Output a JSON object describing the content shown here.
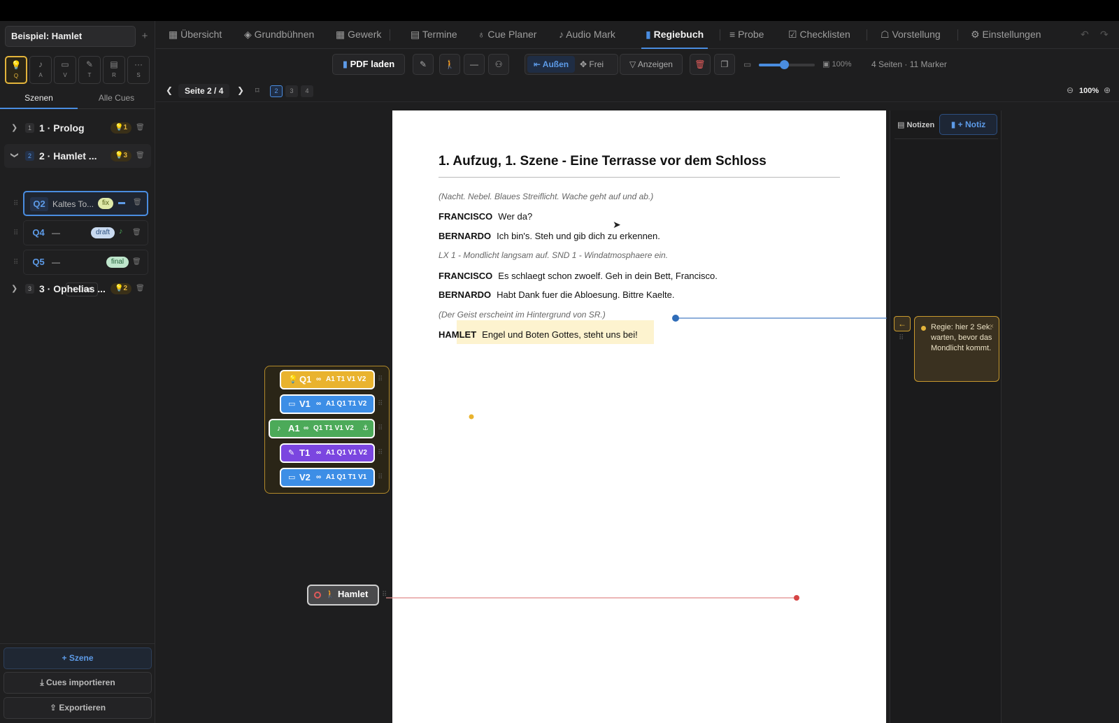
{
  "project": {
    "name": "Beispiel: Hamlet",
    "add": "+"
  },
  "departments": [
    {
      "icon": "💡",
      "letter": "Q"
    },
    {
      "icon": "♪",
      "letter": "A"
    },
    {
      "icon": "▭",
      "letter": "V"
    },
    {
      "icon": "✎",
      "letter": "T"
    },
    {
      "icon": "▤",
      "letter": "R"
    },
    {
      "icon": "···",
      "letter": "S"
    }
  ],
  "sidebar": {
    "tabs": [
      "Szenen",
      "Alle Cues"
    ],
    "scenes": [
      {
        "num": "1",
        "title": "1 · Prolog",
        "count": "1"
      },
      {
        "num": "2",
        "title": "2 · Hamlet ...",
        "count": "3"
      },
      {
        "num": "3",
        "title": "3 · Ophelias ...",
        "count": "2"
      }
    ],
    "cues": [
      {
        "id": "Q2",
        "name": "Kaltes To...",
        "status": "fix"
      },
      {
        "id": "Q4",
        "name": "—",
        "status": "draft"
      },
      {
        "id": "Q5",
        "name": "—",
        "status": "final"
      }
    ],
    "add_cue": "+ Cue",
    "buttons": {
      "scene": "+ Szene",
      "import": "Cues importieren",
      "export": "Exportieren"
    }
  },
  "nav": {
    "tabs": [
      "Übersicht",
      "Grundbühnen",
      "Gewerk",
      "Termine",
      "Cue Planer",
      "Audio Mark",
      "Regiebuch",
      "Probe",
      "Checklisten",
      "Vorstellung",
      "Einstellungen"
    ],
    "active": "Regiebuch"
  },
  "toolbar": {
    "pdf": "PDF laden",
    "outside": "Außen",
    "free": "Frei",
    "show": "Anzeigen",
    "zoom_slider": 0.45,
    "page_zoom": "100%",
    "info": "4 Seiten · 11 Marker"
  },
  "pager": {
    "label": "Seite 2 / 4",
    "pages": [
      "2",
      "3",
      "4"
    ],
    "zoom": "100%"
  },
  "document": {
    "heading": "1. Aufzug, 1. Szene - Eine Terrasse vor dem Schloss",
    "lines": [
      {
        "speaker": "",
        "text": "(Nacht. Nebel. Blaues Streiflicht. Wache geht auf und ab.)"
      },
      {
        "speaker": "FRANCISCO",
        "text": "Wer da?"
      },
      {
        "speaker": "BERNARDO",
        "text": "Ich bin's. Steh und gib dich zu erkennen."
      },
      {
        "speaker": "",
        "text": "LX 1 - Mondlicht langsam auf. SND 1 - Windatmosphaere ein."
      },
      {
        "speaker": "FRANCISCO",
        "text": "Es schlaegt schon zwoelf. Geh in dein Bett, Francisco."
      },
      {
        "speaker": "BERNARDO",
        "text": "Habt Dank fuer die Abloesung. Bittre Kaelte."
      },
      {
        "speaker": "",
        "text": "(Der Geist erscheint im Hintergrund von SR.)"
      },
      {
        "speaker": "HAMLET",
        "text": "Engel und Boten Gottes, steht uns bei!"
      }
    ]
  },
  "notes": {
    "title": "Notizen",
    "add": "+ Notiz",
    "card": "Regie: hier 2 Sek. warten, bevor das Mondlicht kommt."
  },
  "cue_group": [
    {
      "id": "Q1",
      "links": "A1 T1 V1 V2",
      "color": "#e9b32e",
      "icon": "💡"
    },
    {
      "id": "V1",
      "links": "A1 Q1 T1 V2",
      "color": "#3d8ee6",
      "icon": "▭"
    },
    {
      "id": "A1",
      "links": "Q1 T1 V1 V2",
      "color": "#4caa59",
      "icon": "♪"
    },
    {
      "id": "T1",
      "links": "A1 Q1 V1 V2",
      "color": "#7b46e0",
      "icon": "✎"
    },
    {
      "id": "V2",
      "links": "A1 Q1 T1 V1",
      "color": "#3d8ee6",
      "icon": "▭"
    }
  ],
  "actor": {
    "name": "Hamlet"
  },
  "colors": {
    "accent": "#4a8de0",
    "light": "#e3b43b",
    "note": "#c99a2e"
  }
}
